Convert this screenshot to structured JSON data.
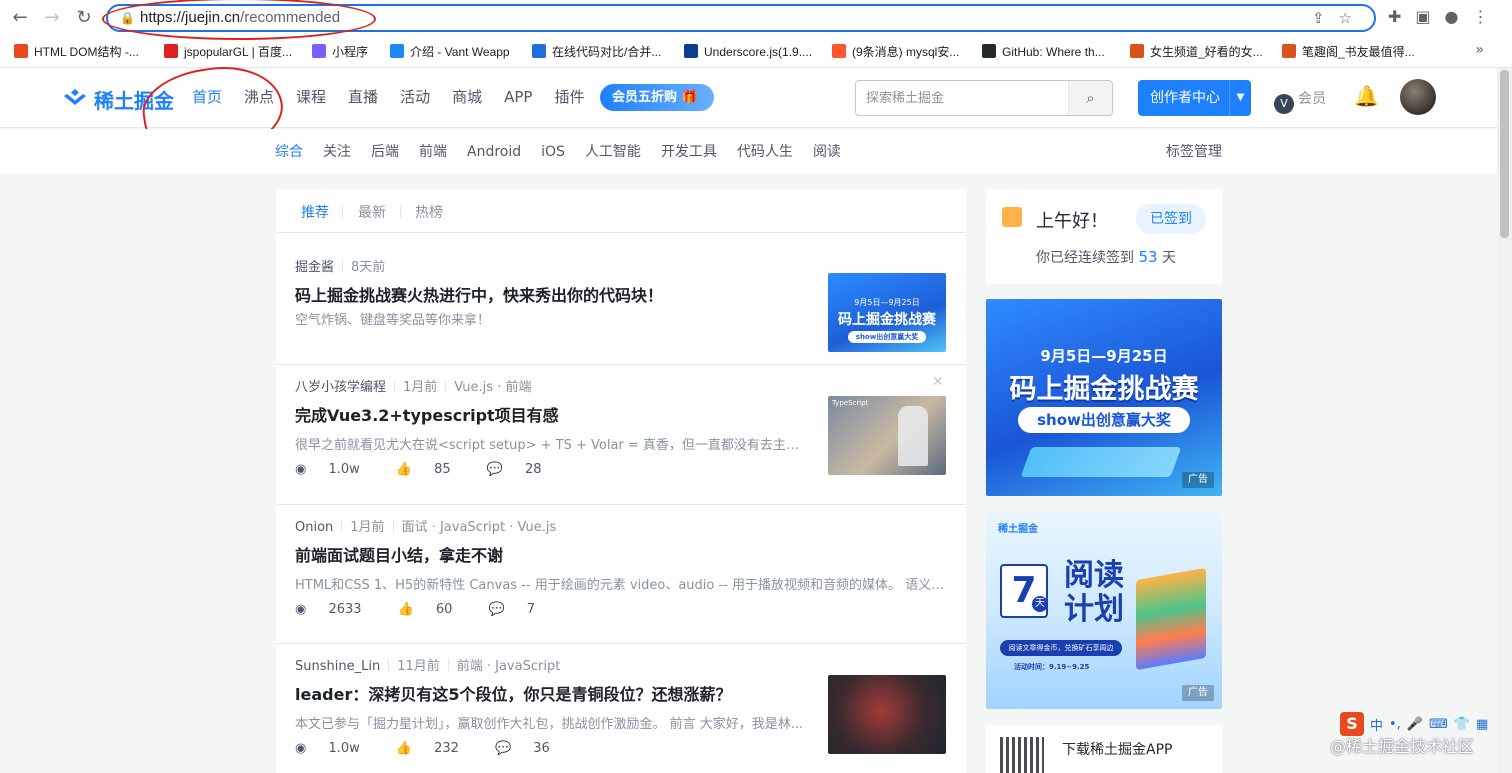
{
  "browser": {
    "url_host": "https://juejin.cn",
    "url_path": "/recommended",
    "bookmarks": [
      {
        "label": "HTML DOM结构 -...",
        "color": "#e8491d"
      },
      {
        "label": "jspopularGL | 百度...",
        "color": "#e02020"
      },
      {
        "label": "小程序",
        "color": "#7b5cff"
      },
      {
        "label": "介绍 - Vant Weapp",
        "color": "#1989fa"
      },
      {
        "label": "在线代码对比/合并...",
        "color": "#1e6fd9"
      },
      {
        "label": "Underscore.js(1.9....",
        "color": "#0b3d91"
      },
      {
        "label": "(9条消息) mysql安...",
        "color": "#fc5531"
      },
      {
        "label": "GitHub: Where th...",
        "color": "#24292f"
      },
      {
        "label": "女生频道_好看的女...",
        "color": "#d9541c"
      },
      {
        "label": "笔趣阁_书友最值得...",
        "color": "#d9541c"
      }
    ]
  },
  "header": {
    "logo_text": "稀土掘金",
    "nav": [
      "首页",
      "沸点",
      "课程",
      "直播",
      "活动",
      "商城",
      "APP",
      "插件"
    ],
    "active_nav": "首页",
    "vip_badge": "会员五折购",
    "search_placeholder": "探索稀土掘金",
    "create_label": "创作者中心",
    "member_label": "会员"
  },
  "subnav": {
    "items": [
      "综合",
      "关注",
      "后端",
      "前端",
      "Android",
      "iOS",
      "人工智能",
      "开发工具",
      "代码人生",
      "阅读"
    ],
    "active": "综合",
    "tag_manage": "标签管理"
  },
  "feed": {
    "tabs": [
      "推荐",
      "最新",
      "热榜"
    ],
    "articles": [
      {
        "author": "掘金酱",
        "time": "8天前",
        "tags": "",
        "title": "码上掘金挑战赛火热进行中，快来秀出你的代码块！",
        "brief": "空气炸锅、键盘等奖品等你来拿！",
        "views": "",
        "likes": "",
        "comments": ""
      },
      {
        "author": "八岁小孩学编程",
        "time": "1月前",
        "tags": "Vue.js · 前端",
        "title": "完成Vue3.2+typescript项目有感",
        "brief": "很早之前就看见尤大在说<script setup> + TS + Volar = 真香，但一直都没有去主动尝...",
        "views": "1.0w",
        "likes": "85",
        "comments": "28"
      },
      {
        "author": "Onion",
        "time": "1月前",
        "tags": "面试 · JavaScript · Vue.js",
        "title": "前端面试题目小结，拿走不谢",
        "brief": "HTML和CSS 1、H5的新特性 Canvas -- 用于绘画的元素 video、audio -- 用于播放视频和音频的媒体。 语义化...",
        "views": "2633",
        "likes": "60",
        "comments": "7"
      },
      {
        "author": "Sunshine_Lin",
        "time": "11月前",
        "tags": "前端 · JavaScript",
        "title": "leader：深拷贝有这5个段位，你只是青铜段位？还想涨薪？",
        "brief": "本文已参与「掘力星计划」，赢取创作大礼包，挑战创作激励金。 前言 大家好，我是林...",
        "views": "1.0w",
        "likes": "232",
        "comments": "36"
      }
    ],
    "thumb1_line1": "9月5日—9月25日",
    "thumb1_line2": "码上掘金挑战赛",
    "thumb1_line3": "show出创意赢大奖",
    "thumb2_text": "TypeScript"
  },
  "sidebar": {
    "greeting": "上午好！",
    "signed_label": "已签到",
    "streak_prefix": "你已经连续签到",
    "streak_days": "53",
    "streak_suffix": "天",
    "ad1_line1": "9月5日—9月25日",
    "ad1_line2": "码上掘金挑战赛",
    "ad1_line3": "show出创意赢大奖",
    "ad_tag": "广告",
    "ad2_brand": "稀土掘金",
    "ad2_days": "7",
    "ad2_days_unit": "天",
    "ad2_title1": "阅读",
    "ad2_title2": "计划",
    "ad2_sub": "阅读文章得金币，兑换矿石享周边",
    "ad2_time": "活动时间：9.19~9.25",
    "app_title": "下载稀土掘金APP"
  },
  "overlay": {
    "ime_label": "中",
    "watermark": "@稀土掘金技术社区"
  },
  "colors": {
    "brand": "#1e80ff",
    "annotation": "#d9241c"
  }
}
